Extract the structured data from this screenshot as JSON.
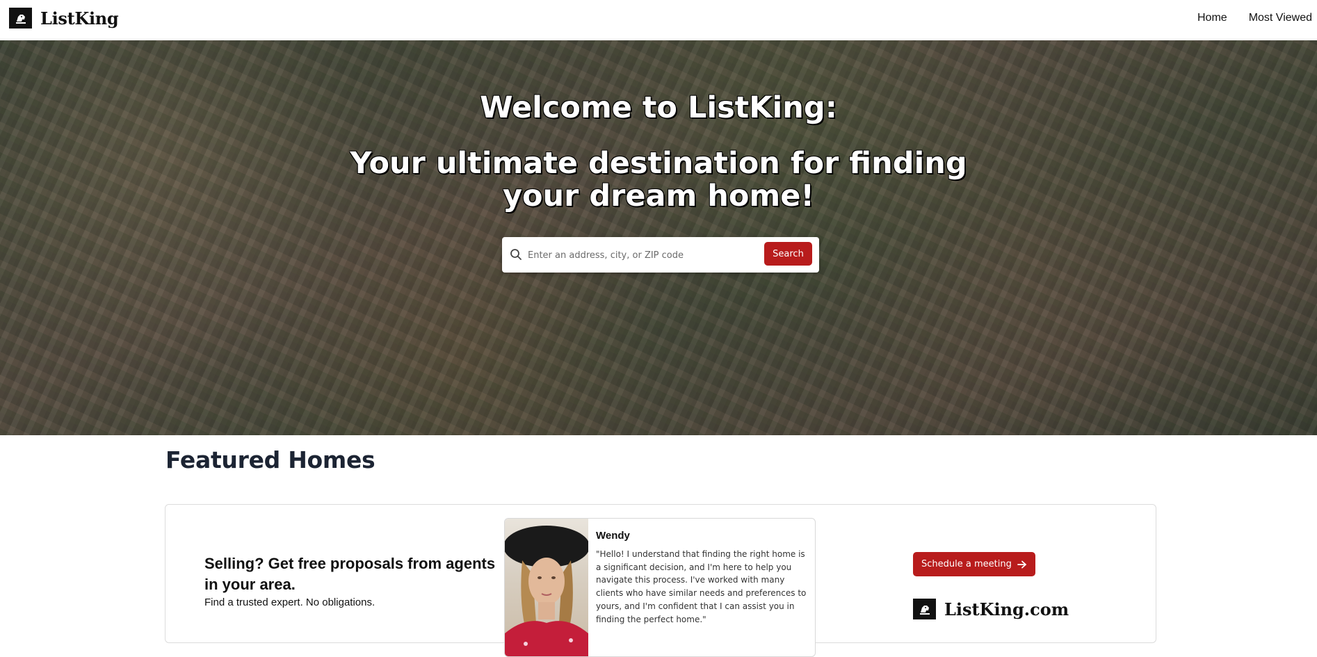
{
  "header": {
    "logo_mark": "LISTKING",
    "brand": "ListKing",
    "nav": [
      {
        "label": "Home"
      },
      {
        "label": "Most Viewed"
      }
    ]
  },
  "hero": {
    "title_line1": "Welcome to ListKing:",
    "title_line2": "Your ultimate destination for finding your dream home!",
    "search": {
      "placeholder": "Enter an address, city, or ZIP code",
      "value": "",
      "button_label": "Search"
    }
  },
  "featured": {
    "title": "Featured Homes",
    "card": {
      "headline": "Selling? Get free proposals from agents in your area.",
      "subtext": "Find a trusted expert. No obligations.",
      "agent": {
        "name": "Wendy",
        "quote": "\"Hello! I understand that finding the right home is a significant decision, and I'm here to help you navigate this process. I've worked with many clients who have similar needs and preferences to yours, and I'm confident that I can assist you in finding the perfect home.\""
      },
      "cta_label": "Schedule a meeting",
      "brand_site": "ListKing.com"
    }
  },
  "colors": {
    "accent": "#b81c1c",
    "heading": "#1c2433"
  },
  "icons": [
    "lion-logo-icon",
    "search-icon",
    "arrow-right-icon"
  ]
}
